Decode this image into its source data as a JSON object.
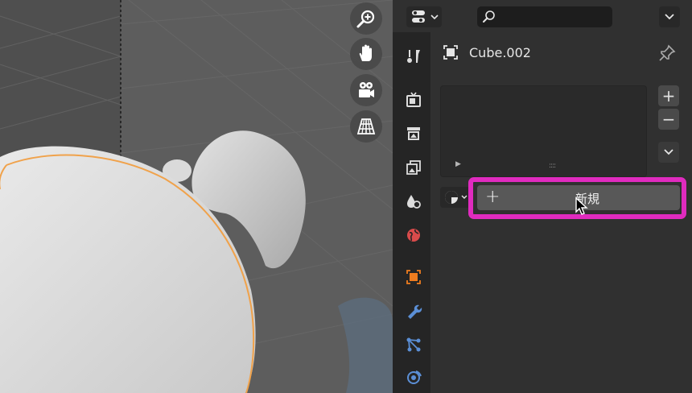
{
  "object": {
    "name": "Cube.002"
  },
  "material": {
    "new_button_label": "新規",
    "new_button_plus": "+",
    "slot_add": "+",
    "slot_remove": "−"
  },
  "colors": {
    "highlight": "#e02bbf",
    "selection_outline": "#f0a24b",
    "active_object": "#f07d1f",
    "modifier": "#5b8fd6",
    "world": "#d94b4b"
  },
  "icons": {
    "viewport_gizmos": [
      "zoom-icon",
      "hand-pan-icon",
      "camera-icon",
      "grid-perspective-icon"
    ],
    "tabs": [
      "tool-icon",
      "render-icon",
      "output-icon",
      "view-layer-icon",
      "scene-icon",
      "world-icon",
      "object-icon",
      "modifier-icon",
      "particles-icon",
      "physics-icon"
    ]
  }
}
